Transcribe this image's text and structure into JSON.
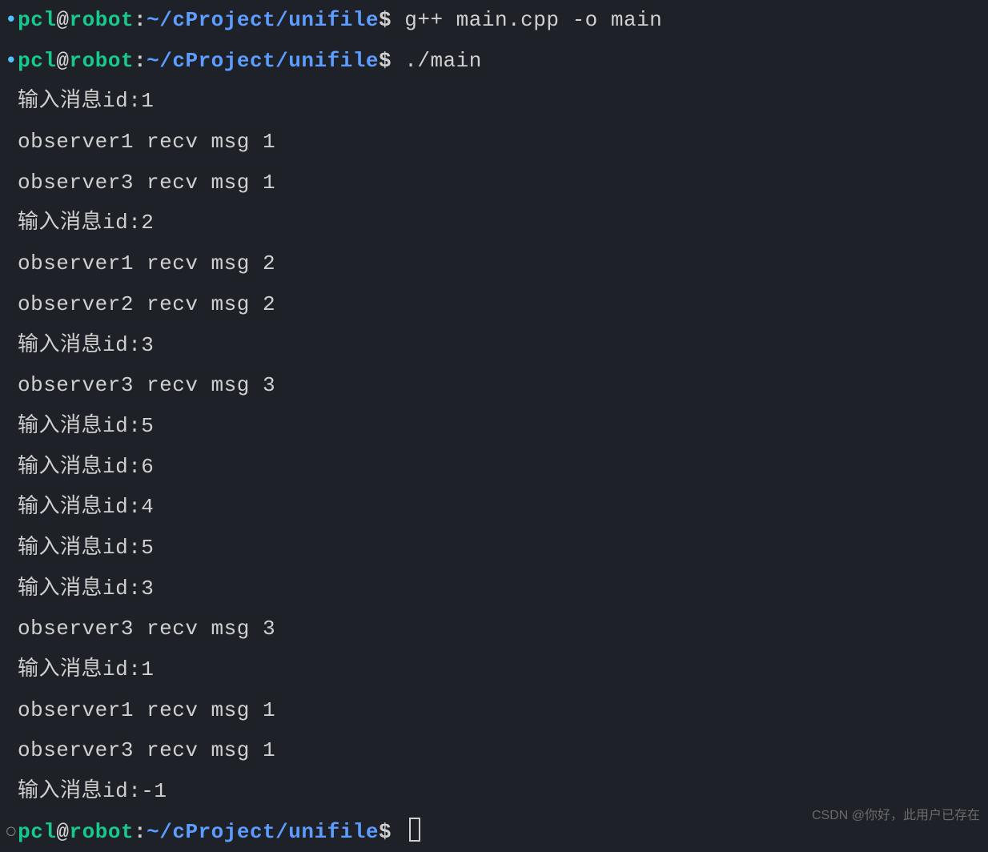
{
  "prompts": [
    {
      "bullet_style": "filled",
      "user": "pcl",
      "host": "robot",
      "path": "~/cProject/unifile",
      "command": "g++ main.cpp -o main"
    },
    {
      "bullet_style": "filled",
      "user": "pcl",
      "host": "robot",
      "path": "~/cProject/unifile",
      "command": "./main"
    }
  ],
  "output": [
    "输入消息id:1",
    "observer1 recv msg 1",
    "observer3 recv msg 1",
    "输入消息id:2",
    "observer1 recv msg 2",
    "observer2 recv msg 2",
    "输入消息id:3",
    "observer3 recv msg 3",
    "输入消息id:5",
    "输入消息id:6",
    "输入消息id:4",
    "输入消息id:5",
    "输入消息id:3",
    "observer3 recv msg 3",
    "输入消息id:1",
    "observer1 recv msg 1",
    "observer3 recv msg 1",
    "输入消息id:-1"
  ],
  "final_prompt": {
    "bullet_style": "hollow",
    "user": "pcl",
    "host": "robot",
    "path": "~/cProject/unifile",
    "command": ""
  },
  "symbols": {
    "at": "@",
    "colon": ":",
    "dollar": "$ ",
    "bullet_filled": "•",
    "bullet_hollow": "○"
  },
  "watermark": "CSDN @你好，此用户已存在"
}
